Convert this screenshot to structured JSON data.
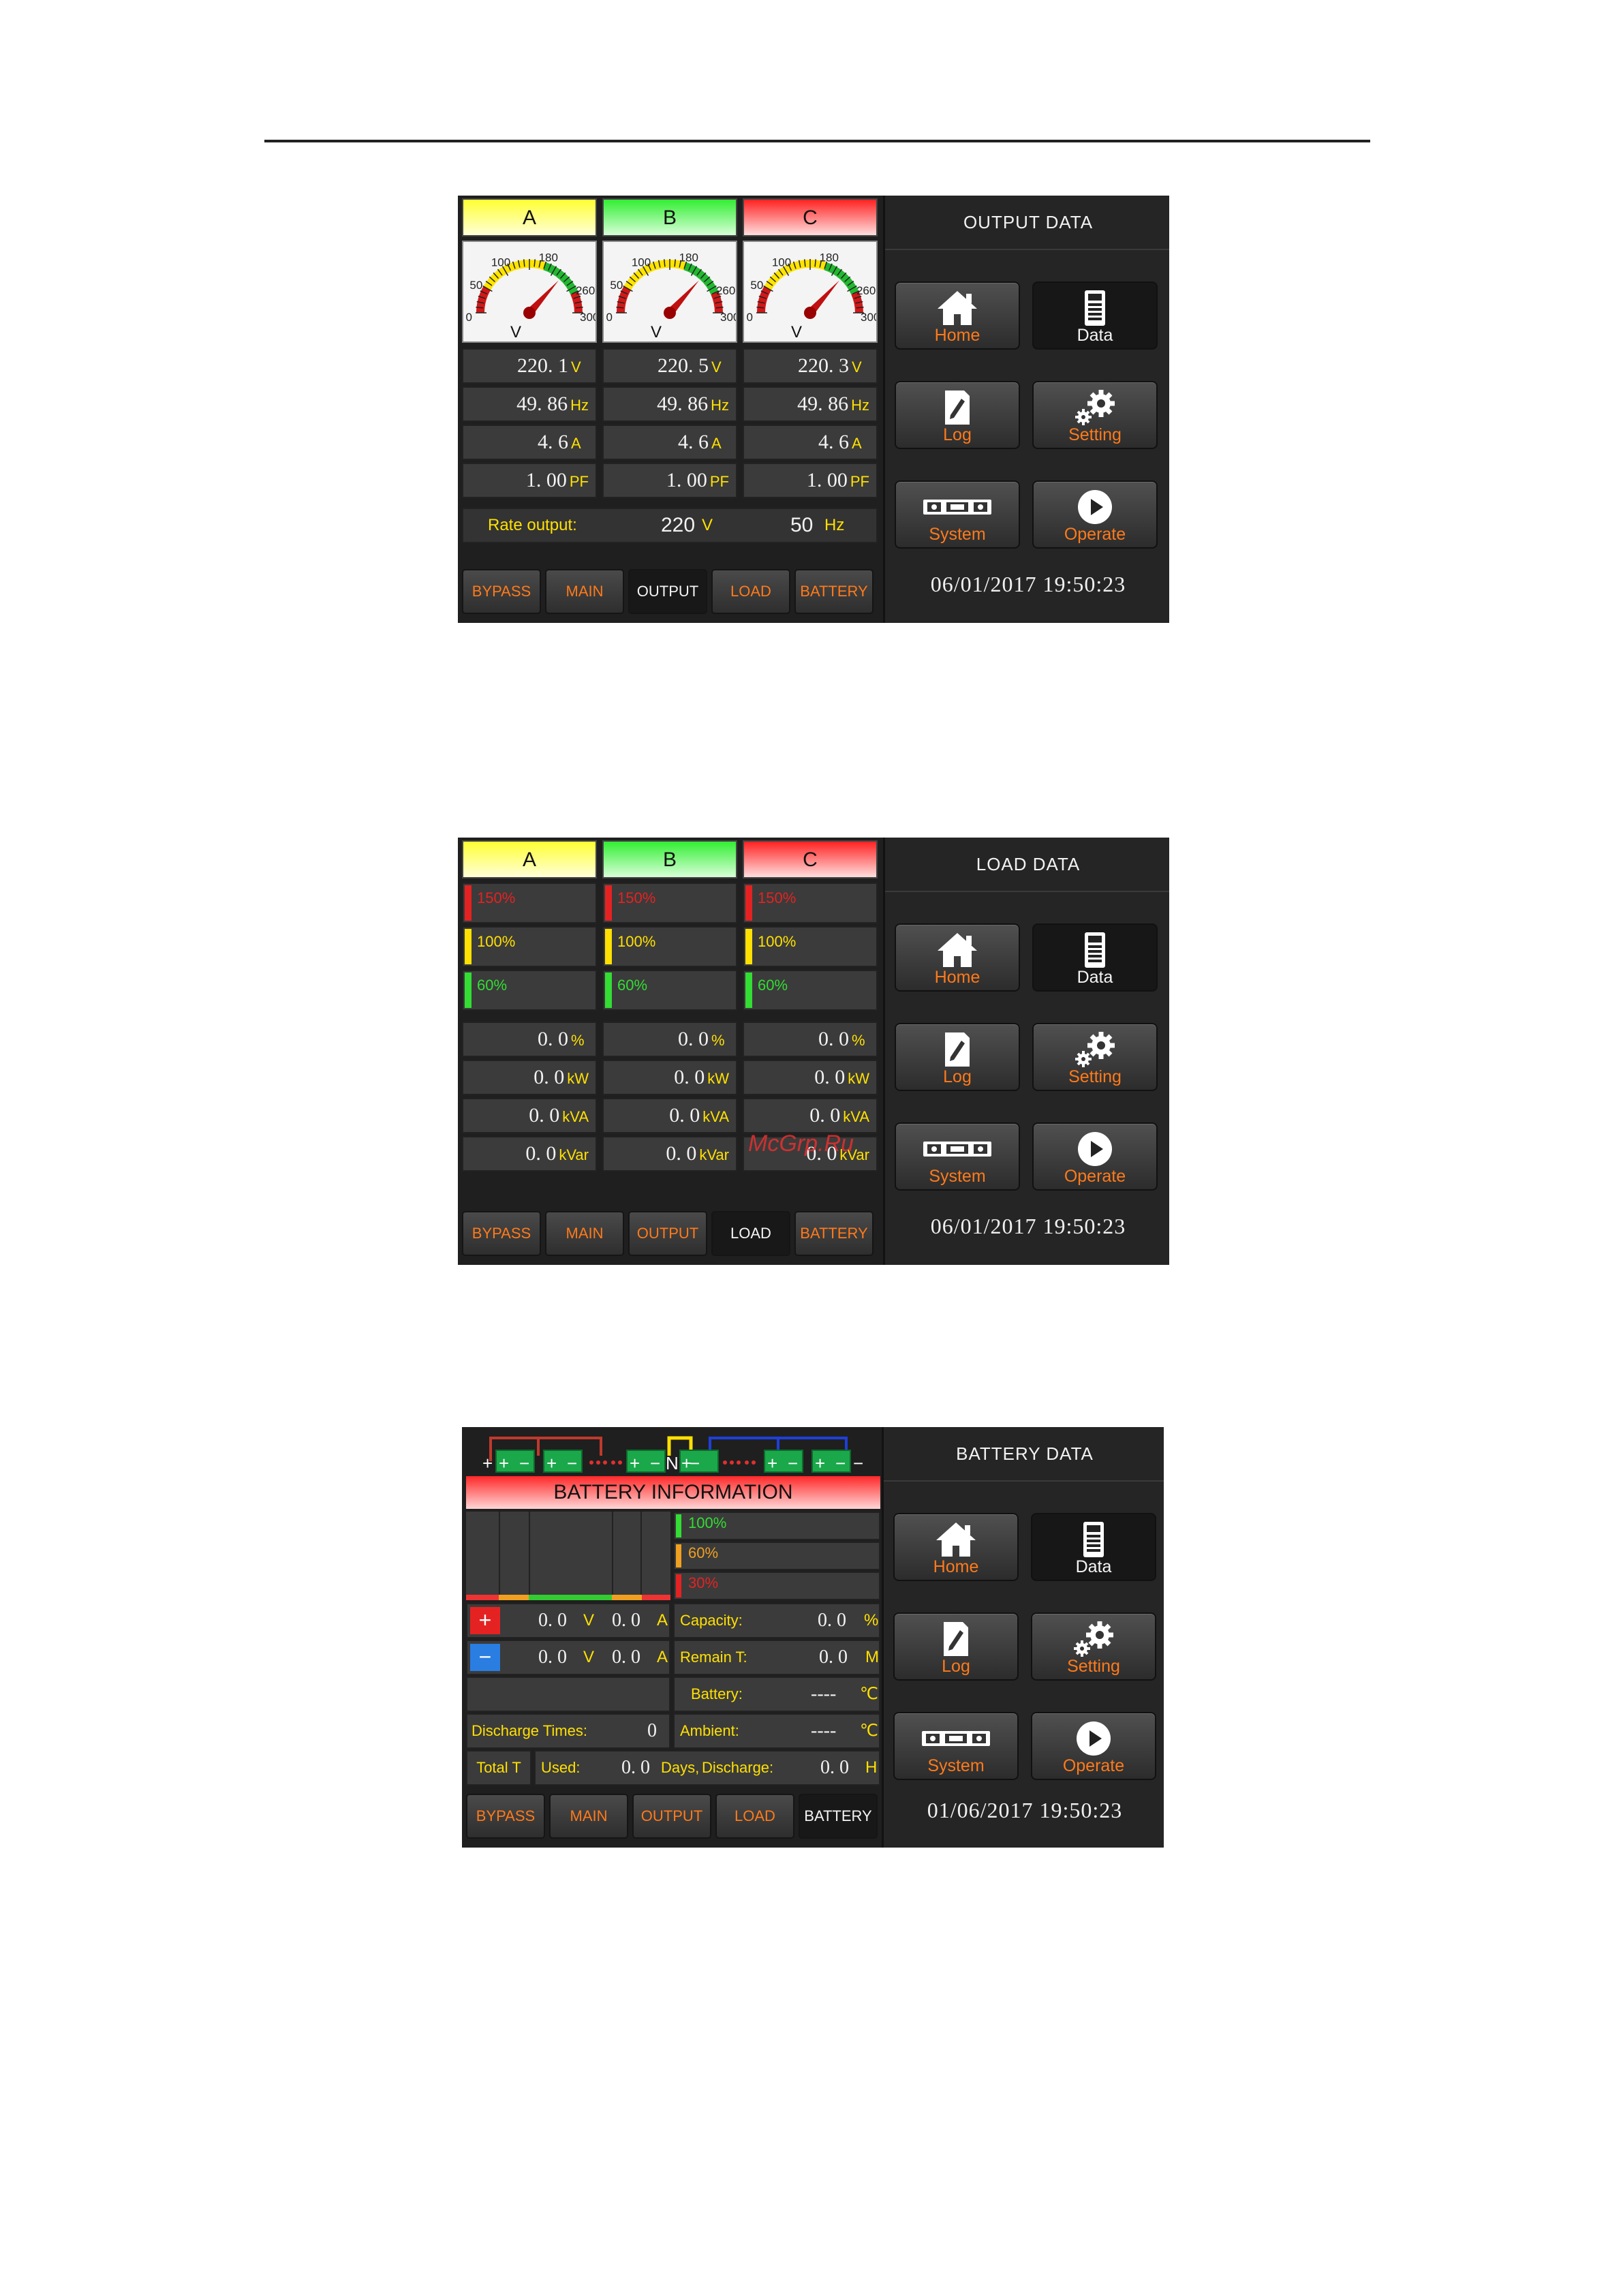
{
  "nav": {
    "home": "Home",
    "data": "Data",
    "log": "Log",
    "setting": "Setting",
    "system": "System",
    "operate": "Operate"
  },
  "phases": [
    "A",
    "B",
    "C"
  ],
  "tabs": [
    "BYPASS",
    "MAIN",
    "OUTPUT",
    "LOAD",
    "BATTERY"
  ],
  "output_screen": {
    "title": "OUTPUT DATA",
    "datetime": "06/01/2017  19:50:23",
    "active_tab": "OUTPUT",
    "gauge": {
      "ticks": [
        "0",
        "50",
        "100",
        "180",
        "260",
        "300"
      ],
      "unit": "V"
    },
    "rows": [
      {
        "unit": "V",
        "values": [
          "220. 1",
          "220. 5",
          "220. 3"
        ]
      },
      {
        "unit": "Hz",
        "values": [
          "49. 86",
          "49. 86",
          "49. 86"
        ]
      },
      {
        "unit": "A",
        "values": [
          "4. 6",
          "4. 6",
          "4. 6"
        ]
      },
      {
        "unit": "PF",
        "values": [
          "1. 00",
          "1. 00",
          "1. 00"
        ]
      }
    ],
    "rate_label": "Rate output:",
    "rate_voltage": "220",
    "rate_voltage_unit": "V",
    "rate_freq": "50",
    "rate_freq_unit": "Hz"
  },
  "load_screen": {
    "title": "LOAD DATA",
    "datetime": "06/01/2017  19:50:23",
    "active_tab": "LOAD",
    "levels": [
      "150%",
      "100%",
      "60%"
    ],
    "rows": [
      {
        "unit": "%",
        "values": [
          "0. 0",
          "0. 0",
          "0. 0"
        ]
      },
      {
        "unit": "kW",
        "values": [
          "0. 0",
          "0. 0",
          "0. 0"
        ]
      },
      {
        "unit": "kVA",
        "values": [
          "0. 0",
          "0. 0",
          "0. 0"
        ]
      },
      {
        "unit": "kVar",
        "values": [
          "0. 0",
          "0. 0",
          "0. 0"
        ]
      }
    ],
    "watermark": "McGrp.Ru"
  },
  "battery_screen": {
    "title": "BATTERY DATA",
    "datetime": "01/06/2017  19:50:23",
    "active_tab": "BATTERY",
    "header": "BATTERY INFORMATION",
    "diagram_mid_label": "N",
    "levels": [
      "100%",
      "60%",
      "30%"
    ],
    "pos_row": {
      "sign": "+",
      "voltage": "0. 0",
      "voltage_unit": "V",
      "current": "0. 0",
      "current_unit": "A"
    },
    "neg_row": {
      "sign": "−",
      "voltage": "0. 0",
      "voltage_unit": "V",
      "current": "0. 0",
      "current_unit": "A"
    },
    "capacity_label": "Capacity:",
    "capacity_value": "0. 0",
    "capacity_unit": "%",
    "remain_label": "Remain T:",
    "remain_value": "0. 0",
    "remain_unit": "M",
    "battery_temp_label": "Battery:",
    "battery_temp_value": "----",
    "battery_temp_unit": "℃",
    "ambient_label": "Ambient:",
    "ambient_value": "----",
    "ambient_unit": "℃",
    "discharge_times_label": "Discharge Times:",
    "discharge_times_value": "0",
    "total_label": "Total T",
    "used_label": "Used:",
    "used_value": "0. 0",
    "used_unit": "Days,",
    "discharge_label": "Discharge:",
    "discharge_value": "0. 0",
    "discharge_unit": "H"
  },
  "colors": {
    "accent": "#ff7a1a",
    "unit_yellow": "#ffe000",
    "phase_a": "#ffff33",
    "phase_b": "#33ee33",
    "phase_c": "#ff2222"
  }
}
